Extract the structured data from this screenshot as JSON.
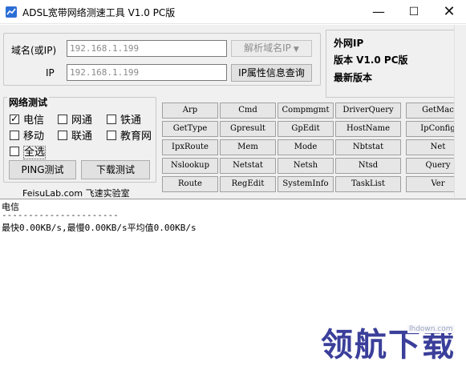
{
  "window": {
    "title": "ADSL宽带网络测速工具 V1.0 PC版",
    "minimize_label": "—",
    "maximize_label": "☐",
    "close_label": "✕"
  },
  "domain_panel": {
    "domain_label": "域名(或IP)",
    "domain_value": "192.168.1.199",
    "resolve_button": "解析域名IP",
    "ip_label": "IP",
    "ip_value": "192.168.1.199",
    "ip_info_button": "IP属性信息查询"
  },
  "info_panel": {
    "line1": "外网IP",
    "line2": "版本 V1.0 PC版",
    "line3": "最新版本"
  },
  "network_test": {
    "group_label": "网络测试",
    "options": [
      {
        "label": "电信",
        "checked": true
      },
      {
        "label": "网通",
        "checked": false
      },
      {
        "label": "铁通",
        "checked": false
      },
      {
        "label": "移动",
        "checked": false
      },
      {
        "label": "联通",
        "checked": false
      },
      {
        "label": "教育网",
        "checked": false
      },
      {
        "label": "全选",
        "checked": false
      }
    ],
    "ping_button": "PING测试",
    "download_button": "下载测试",
    "footer": "FeisuLab.com 飞速实验室"
  },
  "commands": [
    [
      "Arp",
      "Cmd",
      "Compmgmt",
      "DriverQuery",
      "GetMac"
    ],
    [
      "GetType",
      "Gpresult",
      "GpEdit",
      "HostName",
      "IpConfig"
    ],
    [
      "IpxRoute",
      "Mem",
      "Mode",
      "Nbtstat",
      "Net"
    ],
    [
      "Nslookup",
      "Netstat",
      "Netsh",
      "Ntsd",
      "Query"
    ],
    [
      "Route",
      "RegEdit",
      "SystemInfo",
      "TaskList",
      "Ver"
    ]
  ],
  "output": {
    "line1": "电信",
    "line2": "----------------------",
    "line3": "最快0.00KB/s,最慢0.00KB/s平均值0.00KB/s"
  },
  "watermark": {
    "text": "领航下载",
    "site": "lhdown.com"
  }
}
